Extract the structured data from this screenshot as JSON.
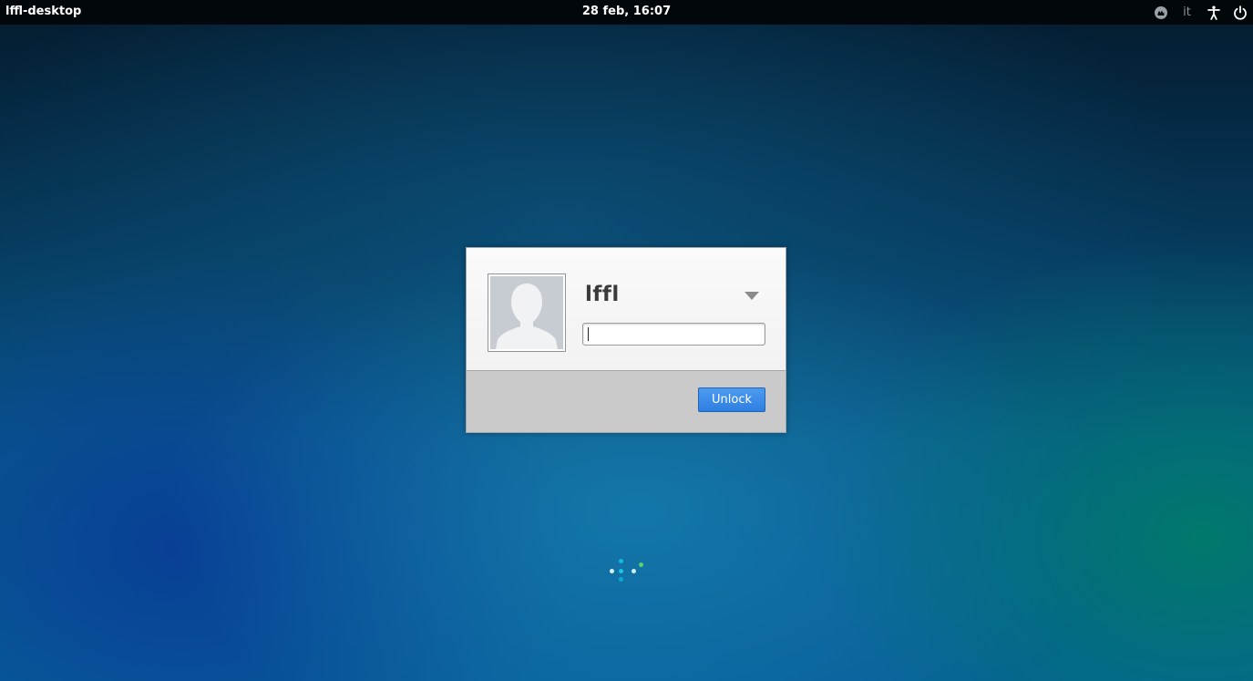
{
  "panel": {
    "host_name": "lffl-desktop",
    "clock": "28 feb, 16:07",
    "indicators": [
      {
        "name": "session-indicator-icon"
      },
      {
        "name": "keyboard-layout",
        "label": "it"
      },
      {
        "name": "accessibility-icon"
      },
      {
        "name": "power-icon"
      }
    ]
  },
  "dialog": {
    "user_name": "lffl",
    "password": {
      "value": "",
      "placeholder": ""
    },
    "unlock_label": "Unlock",
    "avatar_icon": "default-user-silhouette-icon",
    "dropdown_icon": "triangle-down-icon"
  },
  "colors": {
    "panel_bg": "#02070c",
    "button_blue": "#3a88e8",
    "dialog_top": "#f5f5f5",
    "dialog_bottom": "#cacaca",
    "spinner_cyan": "#19c3e6",
    "spinner_green": "#5ad06a"
  }
}
